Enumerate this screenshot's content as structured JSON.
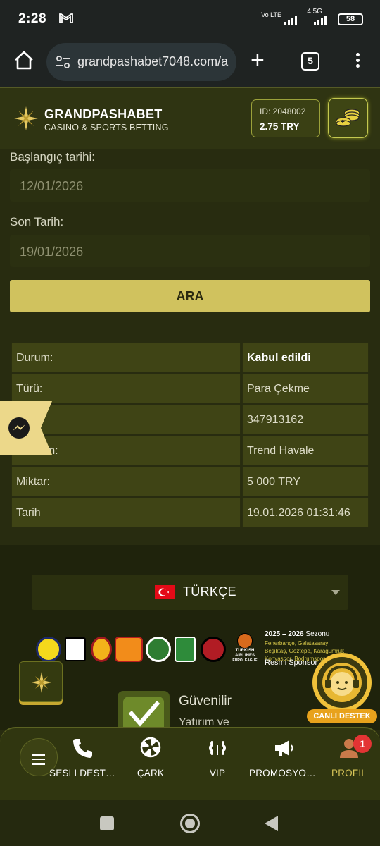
{
  "status_bar": {
    "time": "2:28",
    "mail_icon": "gmail-icon",
    "network": "4.5G",
    "volte": "Vo LTE",
    "battery": "58"
  },
  "browser": {
    "url": "grandpashabet7048.com/a",
    "tab_count": "5"
  },
  "header": {
    "brand": "GRANDPASHABET",
    "tagline": "CASINO & SPORTS BETTING",
    "account_id": "ID: 2048002",
    "balance": "2.75 TRY"
  },
  "form": {
    "start_label": "Başlangıç tarihi:",
    "start_value": "12/01/2026",
    "end_label": "Son Tarih:",
    "end_value": "19/01/2026",
    "search_button": "ARA"
  },
  "details": [
    {
      "key": "Durum:",
      "value": "Kabul edildi"
    },
    {
      "key": "Türü:",
      "value": "Para Çekme"
    },
    {
      "key": "ID:",
      "value": "347913162"
    },
    {
      "key": "Yöntem:",
      "value": "Trend Havale"
    },
    {
      "key": "Miktar:",
      "value": "5 000 TRY"
    },
    {
      "key": "Tarih",
      "value": "19.01.2026 01:31:46"
    }
  ],
  "footer": {
    "language": "TÜRKÇE",
    "sponsor_season": "2025 – 2026",
    "sponsor_season_word": "Sezonu",
    "sponsor_teams": "Fenerbahçe, Galatasaray Beşiktaş, Göztepe, Karagümrük Konyaspor, Bodrumspor",
    "sponsor_label": "Resmi Sponsor",
    "airline_line1": "TURKISH",
    "airline_line2": "AIRLINES",
    "airline_line3": "EUROLEAGUE",
    "trust_line1": "Güvenilir",
    "trust_line2": "Yatırım ve"
  },
  "live_support": {
    "label": "CANLI DESTEK"
  },
  "bottom_nav": {
    "items": [
      {
        "label": "SESLİ DESTEK",
        "icon": "phone-icon"
      },
      {
        "label": "ÇARK",
        "icon": "wheel-icon"
      },
      {
        "label": "VİP",
        "icon": "laurel-icon"
      },
      {
        "label": "PROMOSYONLAR",
        "icon": "megaphone-icon"
      },
      {
        "label": "PROFİL",
        "icon": "user-icon"
      }
    ],
    "profile_badge": "1"
  },
  "colors": {
    "accent": "#d0c25e",
    "background": "#282c10",
    "table_cell": "#3f4415",
    "badge": "#e33434"
  }
}
